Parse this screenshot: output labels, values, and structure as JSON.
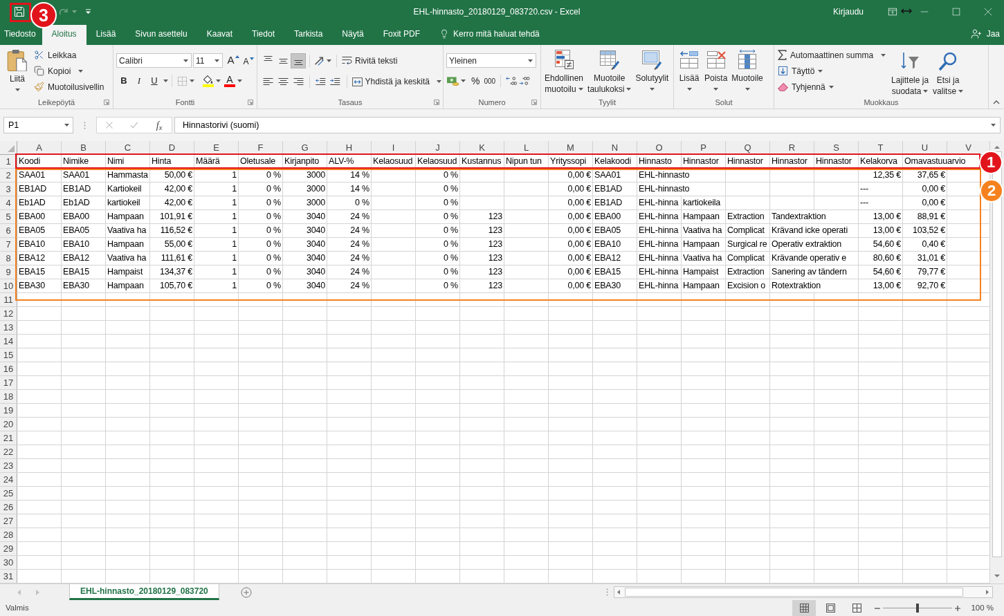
{
  "window": {
    "title": "EHL-hinnasto_20180129_083720.csv - Excel",
    "sign_in": "Kirjaudu",
    "redo": {
      "disabled": true
    }
  },
  "ribbon_tabs": [
    {
      "label": "Tiedosto",
      "selected": false
    },
    {
      "label": "Aloitus",
      "selected": true
    },
    {
      "label": "Lisää",
      "selected": false
    },
    {
      "label": "Sivun asettelu",
      "selected": false
    },
    {
      "label": "Kaavat",
      "selected": false
    },
    {
      "label": "Tiedot",
      "selected": false
    },
    {
      "label": "Tarkista",
      "selected": false
    },
    {
      "label": "Näytä",
      "selected": false
    },
    {
      "label": "Foxit PDF",
      "selected": false
    }
  ],
  "tell_me": "Kerro mitä haluat tehdä",
  "share": "Jaa",
  "clipboard": {
    "label": "Leikepöytä",
    "paste": "Liitä",
    "cut": "Leikkaa",
    "copy": "Kopioi",
    "format_painter": "Muotoilusivellin"
  },
  "font": {
    "label": "Fontti",
    "name": "Calibri",
    "size": "11",
    "size_buttons": [
      {
        "kind": "grow",
        "label": "A"
      },
      {
        "kind": "shrink",
        "label": "A"
      }
    ],
    "styles": [
      {
        "kind": "bold",
        "label": "B",
        "selected": false
      },
      {
        "kind": "italic",
        "label": "I",
        "selected": false
      },
      {
        "kind": "underline",
        "label": "U",
        "selected": false
      }
    ],
    "color_buttons": [
      {
        "kind": "fill",
        "color": "#ffff00"
      },
      {
        "kind": "font",
        "label": "A",
        "color": "#ff0000"
      }
    ]
  },
  "alignment": {
    "label": "Tasaus",
    "vertical": [
      {
        "kind": "top",
        "selected": false
      },
      {
        "kind": "middle",
        "selected": false
      },
      {
        "kind": "bottom",
        "selected": true
      }
    ],
    "horizontal": [
      {
        "kind": "left",
        "selected": false
      },
      {
        "kind": "center",
        "selected": false
      },
      {
        "kind": "right",
        "selected": false
      }
    ],
    "wrap_text": "Rivitä teksti",
    "merge": "Yhdistä ja keskitä"
  },
  "number": {
    "label": "Numero",
    "format": "Yleinen",
    "percent": "%",
    "thousands": "000"
  },
  "styles": {
    "label": "Tyylit",
    "buttons": [
      {
        "kind": "conditional",
        "lines": [
          "Ehdollinen",
          "muotoilu"
        ]
      },
      {
        "kind": "table",
        "lines": [
          "Muotoile",
          "taulukoksi"
        ]
      },
      {
        "kind": "cell_styles",
        "lines": [
          "Solutyylit"
        ]
      }
    ]
  },
  "cells": {
    "label": "Solut",
    "buttons": [
      {
        "kind": "insert",
        "label": "Lisää"
      },
      {
        "kind": "delete",
        "label": "Poista"
      },
      {
        "kind": "format",
        "label": "Muotoile"
      }
    ]
  },
  "editing": {
    "label": "Muokkaus",
    "autosum": "Automaattinen summa",
    "fill": "Täyttö",
    "clear": "Tyhjennä",
    "big_buttons": [
      {
        "kind": "sort_filter",
        "lines": [
          "Lajittele ja",
          "suodata"
        ]
      },
      {
        "kind": "find_select",
        "lines": [
          "Etsi ja",
          "valitse"
        ]
      }
    ]
  },
  "formula_bar": {
    "name_box": "P1",
    "function_label": "f$_{x}$",
    "value": "Hinnastorivi (suomi)"
  },
  "sheet": {
    "columns": [
      "A",
      "B",
      "C",
      "D",
      "E",
      "F",
      "G",
      "H",
      "I",
      "J",
      "K",
      "L",
      "M",
      "N",
      "O",
      "P",
      "Q",
      "R",
      "S",
      "T",
      "U",
      "V"
    ],
    "rows": [
      {
        "number": "1",
        "cells": [
          {
            "text": "Koodi",
            "kind": "text"
          },
          {
            "text": "Nimike",
            "kind": "text"
          },
          {
            "text": "Nimi",
            "kind": "text"
          },
          {
            "text": "Hinta",
            "kind": "text"
          },
          {
            "text": "Määrä",
            "kind": "text"
          },
          {
            "text": "Oletusale",
            "kind": "text"
          },
          {
            "text": "Kirjanpito",
            "kind": "text"
          },
          {
            "text": "ALV-%",
            "kind": "text"
          },
          {
            "text": "Kelaosuud",
            "kind": "text"
          },
          {
            "text": "Kelaosuud",
            "kind": "text"
          },
          {
            "text": "Kustannus",
            "kind": "text"
          },
          {
            "text": "Nipun tun",
            "kind": "text"
          },
          {
            "text": "Yrityssopi",
            "kind": "text"
          },
          {
            "text": "Kelakoodi",
            "kind": "text"
          },
          {
            "text": "Hinnasto",
            "kind": "text"
          },
          {
            "text": "Hinnastor",
            "kind": "text"
          },
          {
            "text": "Hinnastor",
            "kind": "text"
          },
          {
            "text": "Hinnastor",
            "kind": "text"
          },
          {
            "text": "Hinnastor",
            "kind": "text"
          },
          {
            "text": "Kelakorva",
            "kind": "text"
          },
          {
            "text": "Omavastuuarvio",
            "kind": "text"
          }
        ]
      },
      {
        "number": "2",
        "cells": [
          {
            "text": "SAA01",
            "kind": "text"
          },
          {
            "text": "SAA01",
            "kind": "text"
          },
          {
            "text": "Hammasta",
            "kind": "text"
          },
          {
            "text": "50,00 €",
            "kind": "number"
          },
          {
            "text": "1",
            "kind": "number"
          },
          {
            "text": "0 %",
            "kind": "number"
          },
          {
            "text": "3000",
            "kind": "number"
          },
          {
            "text": "14 %",
            "kind": "number"
          },
          null,
          {
            "text": "0 %",
            "kind": "number"
          },
          null,
          null,
          {
            "text": "0,00 €",
            "kind": "number"
          },
          {
            "text": "SAA01",
            "kind": "text"
          },
          {
            "text": "EHL-hinnasto",
            "kind": "text"
          },
          null,
          null,
          null,
          null,
          {
            "text": "12,35 €",
            "kind": "number"
          },
          {
            "text": "37,65 €",
            "kind": "number"
          }
        ]
      },
      {
        "number": "3",
        "cells": [
          {
            "text": "EB1AD",
            "kind": "text"
          },
          {
            "text": "EB1AD",
            "kind": "text"
          },
          {
            "text": "Kartiokeil",
            "kind": "text"
          },
          {
            "text": "42,00 €",
            "kind": "number"
          },
          {
            "text": "1",
            "kind": "number"
          },
          {
            "text": "0 %",
            "kind": "number"
          },
          {
            "text": "3000",
            "kind": "number"
          },
          {
            "text": "14 %",
            "kind": "number"
          },
          null,
          {
            "text": "0 %",
            "kind": "number"
          },
          null,
          null,
          {
            "text": "0,00 €",
            "kind": "number"
          },
          {
            "text": "EB1AD",
            "kind": "text"
          },
          {
            "text": "EHL-hinnasto",
            "kind": "text"
          },
          null,
          null,
          null,
          null,
          {
            "text": "---",
            "kind": "text"
          },
          {
            "text": "0,00 €",
            "kind": "number"
          }
        ]
      },
      {
        "number": "4",
        "cells": [
          {
            "text": "Eb1AD",
            "kind": "text"
          },
          {
            "text": "Eb1AD",
            "kind": "text"
          },
          {
            "text": "kartiokeil",
            "kind": "text"
          },
          {
            "text": "42,00 €",
            "kind": "number"
          },
          {
            "text": "1",
            "kind": "number"
          },
          {
            "text": "0 %",
            "kind": "number"
          },
          {
            "text": "3000",
            "kind": "number"
          },
          {
            "text": "0 %",
            "kind": "number"
          },
          null,
          {
            "text": "0 %",
            "kind": "number"
          },
          null,
          null,
          {
            "text": "0,00 €",
            "kind": "number"
          },
          {
            "text": "EB1AD",
            "kind": "text"
          },
          {
            "text": "EHL-hinna",
            "kind": "text"
          },
          {
            "text": "kartiokeila",
            "kind": "text"
          },
          null,
          null,
          null,
          {
            "text": "---",
            "kind": "text"
          },
          {
            "text": "0,00 €",
            "kind": "number"
          }
        ]
      },
      {
        "number": "5",
        "cells": [
          {
            "text": "EBA00",
            "kind": "text"
          },
          {
            "text": "EBA00",
            "kind": "text"
          },
          {
            "text": "Hampaan",
            "kind": "text"
          },
          {
            "text": "101,91 €",
            "kind": "number"
          },
          {
            "text": "1",
            "kind": "number"
          },
          {
            "text": "0 %",
            "kind": "number"
          },
          {
            "text": "3040",
            "kind": "number"
          },
          {
            "text": "24 %",
            "kind": "number"
          },
          null,
          {
            "text": "0 %",
            "kind": "number"
          },
          {
            "text": "123",
            "kind": "number"
          },
          null,
          {
            "text": "0,00 €",
            "kind": "number"
          },
          {
            "text": "EBA00",
            "kind": "text"
          },
          {
            "text": "EHL-hinna",
            "kind": "text"
          },
          {
            "text": "Hampaan",
            "kind": "text"
          },
          {
            "text": "Extraction",
            "kind": "text"
          },
          {
            "text": "Tandextraktion",
            "kind": "text"
          },
          null,
          {
            "text": "13,00 €",
            "kind": "number"
          },
          {
            "text": "88,91 €",
            "kind": "number"
          }
        ]
      },
      {
        "number": "6",
        "cells": [
          {
            "text": "EBA05",
            "kind": "text"
          },
          {
            "text": "EBA05",
            "kind": "text"
          },
          {
            "text": "Vaativa ha",
            "kind": "text"
          },
          {
            "text": "116,52 €",
            "kind": "number"
          },
          {
            "text": "1",
            "kind": "number"
          },
          {
            "text": "0 %",
            "kind": "number"
          },
          {
            "text": "3040",
            "kind": "number"
          },
          {
            "text": "24 %",
            "kind": "number"
          },
          null,
          {
            "text": "0 %",
            "kind": "number"
          },
          {
            "text": "123",
            "kind": "number"
          },
          null,
          {
            "text": "0,00 €",
            "kind": "number"
          },
          {
            "text": "EBA05",
            "kind": "text"
          },
          {
            "text": "EHL-hinna",
            "kind": "text"
          },
          {
            "text": "Vaativa ha",
            "kind": "text"
          },
          {
            "text": "Complicat",
            "kind": "text"
          },
          {
            "text": "Krävand icke operati",
            "kind": "text"
          },
          null,
          {
            "text": "13,00 €",
            "kind": "number"
          },
          {
            "text": "103,52 €",
            "kind": "number"
          }
        ]
      },
      {
        "number": "7",
        "cells": [
          {
            "text": "EBA10",
            "kind": "text"
          },
          {
            "text": "EBA10",
            "kind": "text"
          },
          {
            "text": "Hampaan",
            "kind": "text"
          },
          {
            "text": "55,00 €",
            "kind": "number"
          },
          {
            "text": "1",
            "kind": "number"
          },
          {
            "text": "0 %",
            "kind": "number"
          },
          {
            "text": "3040",
            "kind": "number"
          },
          {
            "text": "24 %",
            "kind": "number"
          },
          null,
          {
            "text": "0 %",
            "kind": "number"
          },
          {
            "text": "123",
            "kind": "number"
          },
          null,
          {
            "text": "0,00 €",
            "kind": "number"
          },
          {
            "text": "EBA10",
            "kind": "text"
          },
          {
            "text": "EHL-hinna",
            "kind": "text"
          },
          {
            "text": "Hampaan",
            "kind": "text"
          },
          {
            "text": "Surgical re",
            "kind": "text"
          },
          {
            "text": "Operativ extraktion",
            "kind": "text"
          },
          null,
          {
            "text": "54,60 €",
            "kind": "number"
          },
          {
            "text": "0,40 €",
            "kind": "number"
          }
        ]
      },
      {
        "number": "8",
        "cells": [
          {
            "text": "EBA12",
            "kind": "text"
          },
          {
            "text": "EBA12",
            "kind": "text"
          },
          {
            "text": "Vaativa ha",
            "kind": "text"
          },
          {
            "text": "111,61 €",
            "kind": "number"
          },
          {
            "text": "1",
            "kind": "number"
          },
          {
            "text": "0 %",
            "kind": "number"
          },
          {
            "text": "3040",
            "kind": "number"
          },
          {
            "text": "24 %",
            "kind": "number"
          },
          null,
          {
            "text": "0 %",
            "kind": "number"
          },
          {
            "text": "123",
            "kind": "number"
          },
          null,
          {
            "text": "0,00 €",
            "kind": "number"
          },
          {
            "text": "EBA12",
            "kind": "text"
          },
          {
            "text": "EHL-hinna",
            "kind": "text"
          },
          {
            "text": "Vaativa ha",
            "kind": "text"
          },
          {
            "text": "Complicat",
            "kind": "text"
          },
          {
            "text": "Krävande operativ e",
            "kind": "text"
          },
          null,
          {
            "text": "80,60 €",
            "kind": "number"
          },
          {
            "text": "31,01 €",
            "kind": "number"
          }
        ]
      },
      {
        "number": "9",
        "cells": [
          {
            "text": "EBA15",
            "kind": "text"
          },
          {
            "text": "EBA15",
            "kind": "text"
          },
          {
            "text": "Hampaist",
            "kind": "text"
          },
          {
            "text": "134,37 €",
            "kind": "number"
          },
          {
            "text": "1",
            "kind": "number"
          },
          {
            "text": "0 %",
            "kind": "number"
          },
          {
            "text": "3040",
            "kind": "number"
          },
          {
            "text": "24 %",
            "kind": "number"
          },
          null,
          {
            "text": "0 %",
            "kind": "number"
          },
          {
            "text": "123",
            "kind": "number"
          },
          null,
          {
            "text": "0,00 €",
            "kind": "number"
          },
          {
            "text": "EBA15",
            "kind": "text"
          },
          {
            "text": "EHL-hinna",
            "kind": "text"
          },
          {
            "text": "Hampaist",
            "kind": "text"
          },
          {
            "text": "Extraction",
            "kind": "text"
          },
          {
            "text": "Sanering av tändern",
            "kind": "text"
          },
          null,
          {
            "text": "54,60 €",
            "kind": "number"
          },
          {
            "text": "79,77 €",
            "kind": "number"
          }
        ]
      },
      {
        "number": "10",
        "cells": [
          {
            "text": "EBA30",
            "kind": "text"
          },
          {
            "text": "EBA30",
            "kind": "text"
          },
          {
            "text": "Hampaan",
            "kind": "text"
          },
          {
            "text": "105,70 €",
            "kind": "number"
          },
          {
            "text": "1",
            "kind": "number"
          },
          {
            "text": "0 %",
            "kind": "number"
          },
          {
            "text": "3040",
            "kind": "number"
          },
          {
            "text": "24 %",
            "kind": "number"
          },
          null,
          {
            "text": "0 %",
            "kind": "number"
          },
          {
            "text": "123",
            "kind": "number"
          },
          null,
          {
            "text": "0,00 €",
            "kind": "number"
          },
          {
            "text": "EBA30",
            "kind": "text"
          },
          {
            "text": "EHL-hinna",
            "kind": "text"
          },
          {
            "text": "Hampaan",
            "kind": "text"
          },
          {
            "text": "Excision o",
            "kind": "text"
          },
          {
            "text": "Rotextraktion",
            "kind": "text"
          },
          null,
          {
            "text": "13,00 €",
            "kind": "number"
          },
          {
            "text": "92,70 €",
            "kind": "number"
          }
        ]
      },
      {
        "number": "11"
      },
      {
        "number": "12"
      },
      {
        "number": "13"
      },
      {
        "number": "14"
      },
      {
        "number": "15"
      },
      {
        "number": "16"
      },
      {
        "number": "17"
      },
      {
        "number": "18"
      },
      {
        "number": "19"
      },
      {
        "number": "20"
      },
      {
        "number": "21"
      },
      {
        "number": "22"
      },
      {
        "number": "23"
      },
      {
        "number": "24"
      },
      {
        "number": "25"
      },
      {
        "number": "26"
      },
      {
        "number": "27"
      },
      {
        "number": "28"
      },
      {
        "number": "29"
      },
      {
        "number": "30"
      },
      {
        "number": "31"
      }
    ]
  },
  "sheet_tabs": [
    {
      "label": "EHL-hinnasto_20180129_083720",
      "selected": true
    }
  ],
  "status_bar": {
    "status": "Valmis",
    "views": [
      {
        "kind": "normal",
        "selected": true
      },
      {
        "kind": "page_layout",
        "selected": false
      },
      {
        "kind": "page_break",
        "selected": false
      }
    ],
    "zoom": {
      "level": 0.5,
      "reading": "100 %"
    }
  },
  "annotations": [
    {
      "kind": "header_row",
      "label": "1",
      "color": "#e2141b"
    },
    {
      "kind": "data_rows",
      "label": "2",
      "color": "#f5821f"
    },
    {
      "kind": "save_button",
      "label": "3",
      "color": "#e2141b"
    }
  ]
}
